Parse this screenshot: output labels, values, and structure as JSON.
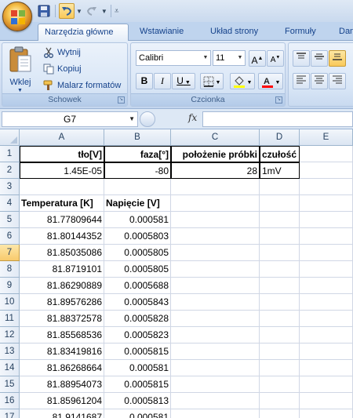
{
  "quick_access": {
    "icons": [
      "save-icon",
      "undo-icon",
      "redo-icon",
      "customize-qat-icon"
    ]
  },
  "tabs": [
    {
      "label": "Narzędzia główne",
      "active": true
    },
    {
      "label": "Wstawianie",
      "active": false
    },
    {
      "label": "Układ strony",
      "active": false
    },
    {
      "label": "Formuły",
      "active": false
    },
    {
      "label": "Dan",
      "active": false
    }
  ],
  "ribbon": {
    "clipboard": {
      "paste_label": "Wklej",
      "cut_label": "Wytnij",
      "copy_label": "Kopiuj",
      "format_painter_label": "Malarz formatów",
      "group_label": "Schowek"
    },
    "font": {
      "font_name": "Calibri",
      "font_size": "11",
      "bold": "B",
      "italic": "I",
      "underline": "U",
      "group_label": "Czcionka",
      "fill_color": "#ffff00",
      "font_color": "#ff0000"
    }
  },
  "formula_bar": {
    "name_box": "G7",
    "fx": "fx",
    "formula": ""
  },
  "sheet": {
    "columns": [
      "A",
      "B",
      "C",
      "D",
      "E"
    ],
    "rows": [
      "1",
      "2",
      "3",
      "4",
      "5",
      "6",
      "7",
      "8",
      "9",
      "10",
      "11",
      "12",
      "13",
      "14",
      "15",
      "16",
      "17"
    ],
    "selected_row": "7",
    "cells": {
      "A1": "tło[V]",
      "B1": "faza[°]",
      "C1": "położenie próbki",
      "D1": "czułość",
      "A2": "1.45E-05",
      "B2": "-80",
      "C2": "28",
      "D2": "1mV",
      "A4": "Temperatura [K]",
      "B4": "Napięcie [V]",
      "A5": "81.77809644",
      "B5": "0.000581",
      "A6": "81.80144352",
      "B6": "0.0005803",
      "A7": "81.85035086",
      "B7": "0.0005805",
      "A8": "81.8719101",
      "B8": "0.0005805",
      "A9": "81.86290889",
      "B9": "0.0005688",
      "A10": "81.89576286",
      "B10": "0.0005843",
      "A11": "81.88372578",
      "B11": "0.0005828",
      "A12": "81.85568536",
      "B12": "0.0005823",
      "A13": "81.83419816",
      "B13": "0.0005815",
      "A14": "81.86268664",
      "B14": "0.000581",
      "A15": "81.88954073",
      "B15": "0.0005815",
      "A16": "81.85961204",
      "B16": "0.0005813",
      "A17": "81.9141687",
      "B17": "0.000581"
    }
  }
}
